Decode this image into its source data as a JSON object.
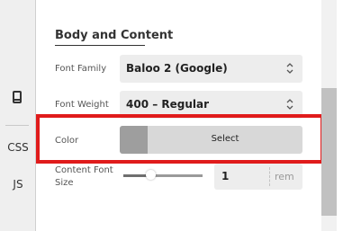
{
  "rail": {
    "items": [
      {
        "name": "mobile",
        "icon": "mobile-device-icon"
      },
      {
        "name": "css",
        "label": "CSS"
      },
      {
        "name": "js",
        "label": "JS"
      }
    ]
  },
  "panel": {
    "section_title": "Body and Content",
    "font_family": {
      "label": "Font Family",
      "value": "Baloo 2 (Google)"
    },
    "font_weight": {
      "label": "Font Weight",
      "value": "400 – Regular"
    },
    "color": {
      "label": "Color",
      "button_label": "Select",
      "swatch_color": "#9e9e9e"
    },
    "content_font_size": {
      "label_line1": "Content Font",
      "label_line2": "Size",
      "value": "1",
      "unit": "rem",
      "slider_value": 0.35
    }
  },
  "highlight": {
    "color": "#e01b1b"
  }
}
